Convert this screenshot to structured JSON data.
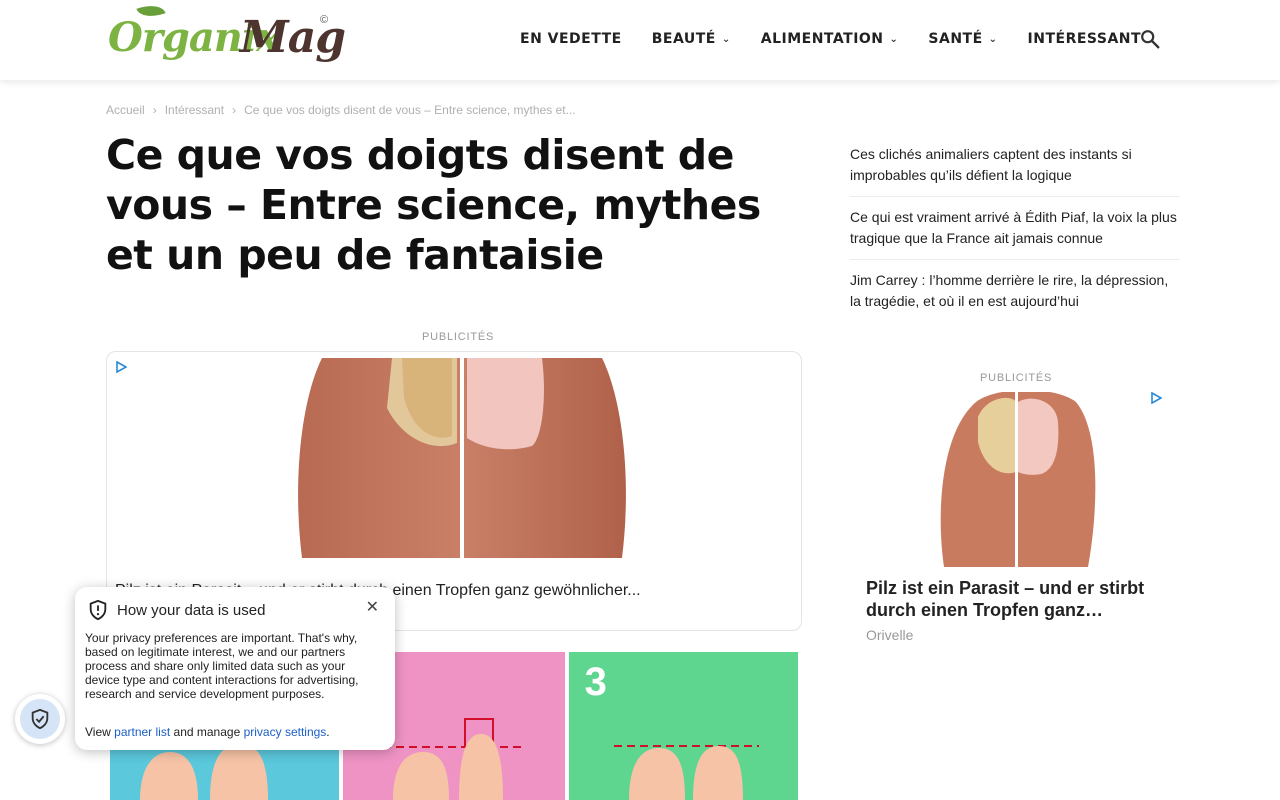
{
  "header": {
    "logo_text_1": "Organix",
    "logo_text_2": "Mag",
    "logo_copyright": "©",
    "nav": [
      {
        "label": "EN VEDETTE",
        "has_dropdown": false
      },
      {
        "label": "BEAUTÉ",
        "has_dropdown": true
      },
      {
        "label": "ALIMENTATION",
        "has_dropdown": true
      },
      {
        "label": "SANTÉ",
        "has_dropdown": true
      },
      {
        "label": "INTÉRESSANT",
        "has_dropdown": false
      }
    ],
    "search_icon": "search-icon"
  },
  "breadcrumb": {
    "items": [
      "Accueil",
      "Intéressant",
      "Ce que vos doigts disent de vous – Entre science, mythes et..."
    ],
    "separator": "›"
  },
  "article": {
    "title": "Ce que vos doigts disent de vous – Entre science, mythes et un peu de fantaisie",
    "ad_label": "PUBLICITÉS",
    "ad_headline": "Pilz ist ein Parasit – und er stirbt durch einen Tropfen ganz gewöhnlicher...",
    "image_panel_number": "3"
  },
  "sidebar": {
    "links": [
      "Ces clichés animaliers captent des instants si improbables qu’ils défient la logique",
      "Ce qui est vraiment arrivé à Édith Piaf, la voix la plus tragique que la France ait jamais connue",
      "Jim Carrey : l’homme derrière le rire, la dépression, la tragédie, et où il en est aujourd’hui"
    ],
    "ad_label": "PUBLICITÉS",
    "ad_headline": "Pilz ist ein Parasit – und er stirbt durch einen Tropfen ganz…",
    "ad_source": "Orivelle"
  },
  "privacy": {
    "title": "How your data is used",
    "body": "Your privacy preferences are important. That's why, based on legitimate interest, we and our partners process and share only limited data such as your device type and content interactions for advertising, research and service development purposes.",
    "links_prefix": "View",
    "partner_link": "partner list",
    "links_middle": "and manage",
    "settings_link": "privacy settings",
    "links_suffix": "."
  },
  "colors": {
    "logo_green": "#7cb342",
    "logo_brown": "#4e342e",
    "link_blue": "#1a5fc8",
    "panel_blue": "#5bc8dc",
    "panel_pink": "#ee93c4",
    "panel_green": "#5fd68f"
  }
}
